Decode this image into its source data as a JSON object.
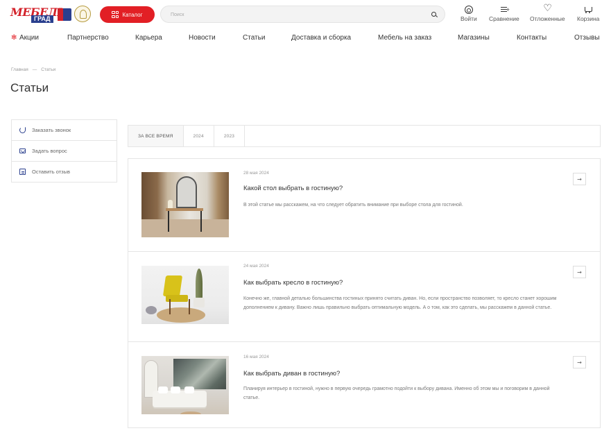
{
  "header": {
    "logo": {
      "brand": "МЕБЕЛЬ",
      "sub": "ГРАД"
    },
    "catalog_label": "Каталог",
    "search_placeholder": "Поиск",
    "actions": {
      "login": "Войти",
      "compare": "Сравнение",
      "favorites": "Отложенные",
      "cart": "Корзина"
    }
  },
  "nav": {
    "items": [
      "Акции",
      "Партнерство",
      "Карьера",
      "Новости",
      "Статьи",
      "Доставка и сборка",
      "Мебель на заказ",
      "Магазины",
      "Контакты",
      "Отзывы"
    ]
  },
  "breadcrumb": {
    "home": "Главная",
    "separator": "—",
    "current": "Статьи"
  },
  "page_title": "Статьи",
  "sidebar": {
    "items": [
      {
        "label": "Заказать звонок",
        "icon": "phone-icon"
      },
      {
        "label": "Задать вопрос",
        "icon": "mail-icon"
      },
      {
        "label": "Оставить отзыв",
        "icon": "chat-icon"
      }
    ]
  },
  "filters": {
    "tabs": [
      "ЗА ВСЕ ВРЕМЯ",
      "2024",
      "2023"
    ],
    "active": "ЗА ВСЕ ВРЕМЯ"
  },
  "articles": [
    {
      "date": "28 мая 2024",
      "title": "Какой стол выбрать в гостиную?",
      "description": "В этой статье мы расскажем, на что следует обратить внимание при выборе стола для гостиной."
    },
    {
      "date": "24 мая 2024",
      "title": "Как выбрать кресло в гостиную?",
      "description": "Конечно же, главной деталью большинства гостиных принято считать диван. Но, если пространство позволяет, то кресло станет хорошим дополнением к дивану. Важно лишь правильно выбрать оптимальную модель. А о том, как это сделать, мы расскажем в данной статье."
    },
    {
      "date": "16 мая 2024",
      "title": "Как выбрать диван в гостиную?",
      "description": "Планируя интерьер в гостиной, нужно в первую очередь грамотно подойти к выбору дивана. Именно об этом мы и поговорим в данной статье."
    }
  ],
  "colors": {
    "accent": "#e21f25",
    "brand_blue": "#2a3f8e",
    "border": "#e5e5e5"
  }
}
